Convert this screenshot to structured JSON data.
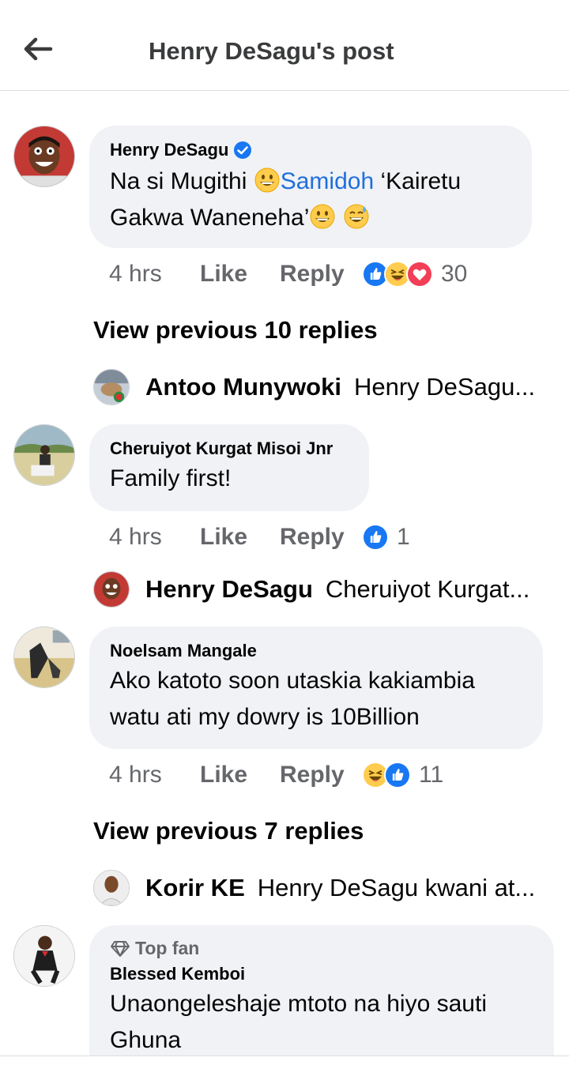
{
  "header": {
    "title": "Henry DeSagu's post"
  },
  "comments": [
    {
      "author": "Henry DeSagu",
      "text_a": "Na si Mugithi ",
      "mention": "Samidoh",
      "text_b": " ‘Kairetu Gakwa Waneneha’",
      "time": "4 hrs",
      "like": "Like",
      "reply": "Reply",
      "react_count": "30"
    },
    {
      "author": "Cheruiyot Kurgat Misoi Jnr",
      "text": "Family first!",
      "time": "4 hrs",
      "like": "Like",
      "reply": "Reply",
      "react_count": "1"
    },
    {
      "author": "Noelsam Mangale",
      "text": "Ako katoto soon utaskia kakiambia watu ati my dowry is 10Billion",
      "time": "4 hrs",
      "like": "Like",
      "reply": "Reply",
      "react_count": "11"
    },
    {
      "badge": "Top fan",
      "author": "Blessed Kemboi",
      "text": "Unaongeleshaje mtoto na hiyo sauti Ghuna"
    }
  ],
  "view_previous": [
    "View previous 10 replies",
    "View previous 7 replies"
  ],
  "replies": [
    {
      "name": "Antoo Munywoki",
      "snippet": "Henry DeSagu..."
    },
    {
      "name": "Henry DeSagu",
      "snippet": "Cheruiyot Kurgat..."
    },
    {
      "name": "Korir KE",
      "snippet": "Henry DeSagu kwani at..."
    }
  ],
  "icons": {
    "back": "arrow-left-icon",
    "verified": "verified-badge-icon",
    "like_reaction": "like-reaction-icon",
    "haha_reaction": "haha-reaction-icon",
    "love_reaction": "love-reaction-icon",
    "top_fan": "diamond-icon"
  },
  "colors": {
    "mention": "#216fdb",
    "bubble": "#f0f2f5",
    "meta": "#65676b",
    "like_blue": "#1877f2",
    "love_red": "#f33e58"
  }
}
